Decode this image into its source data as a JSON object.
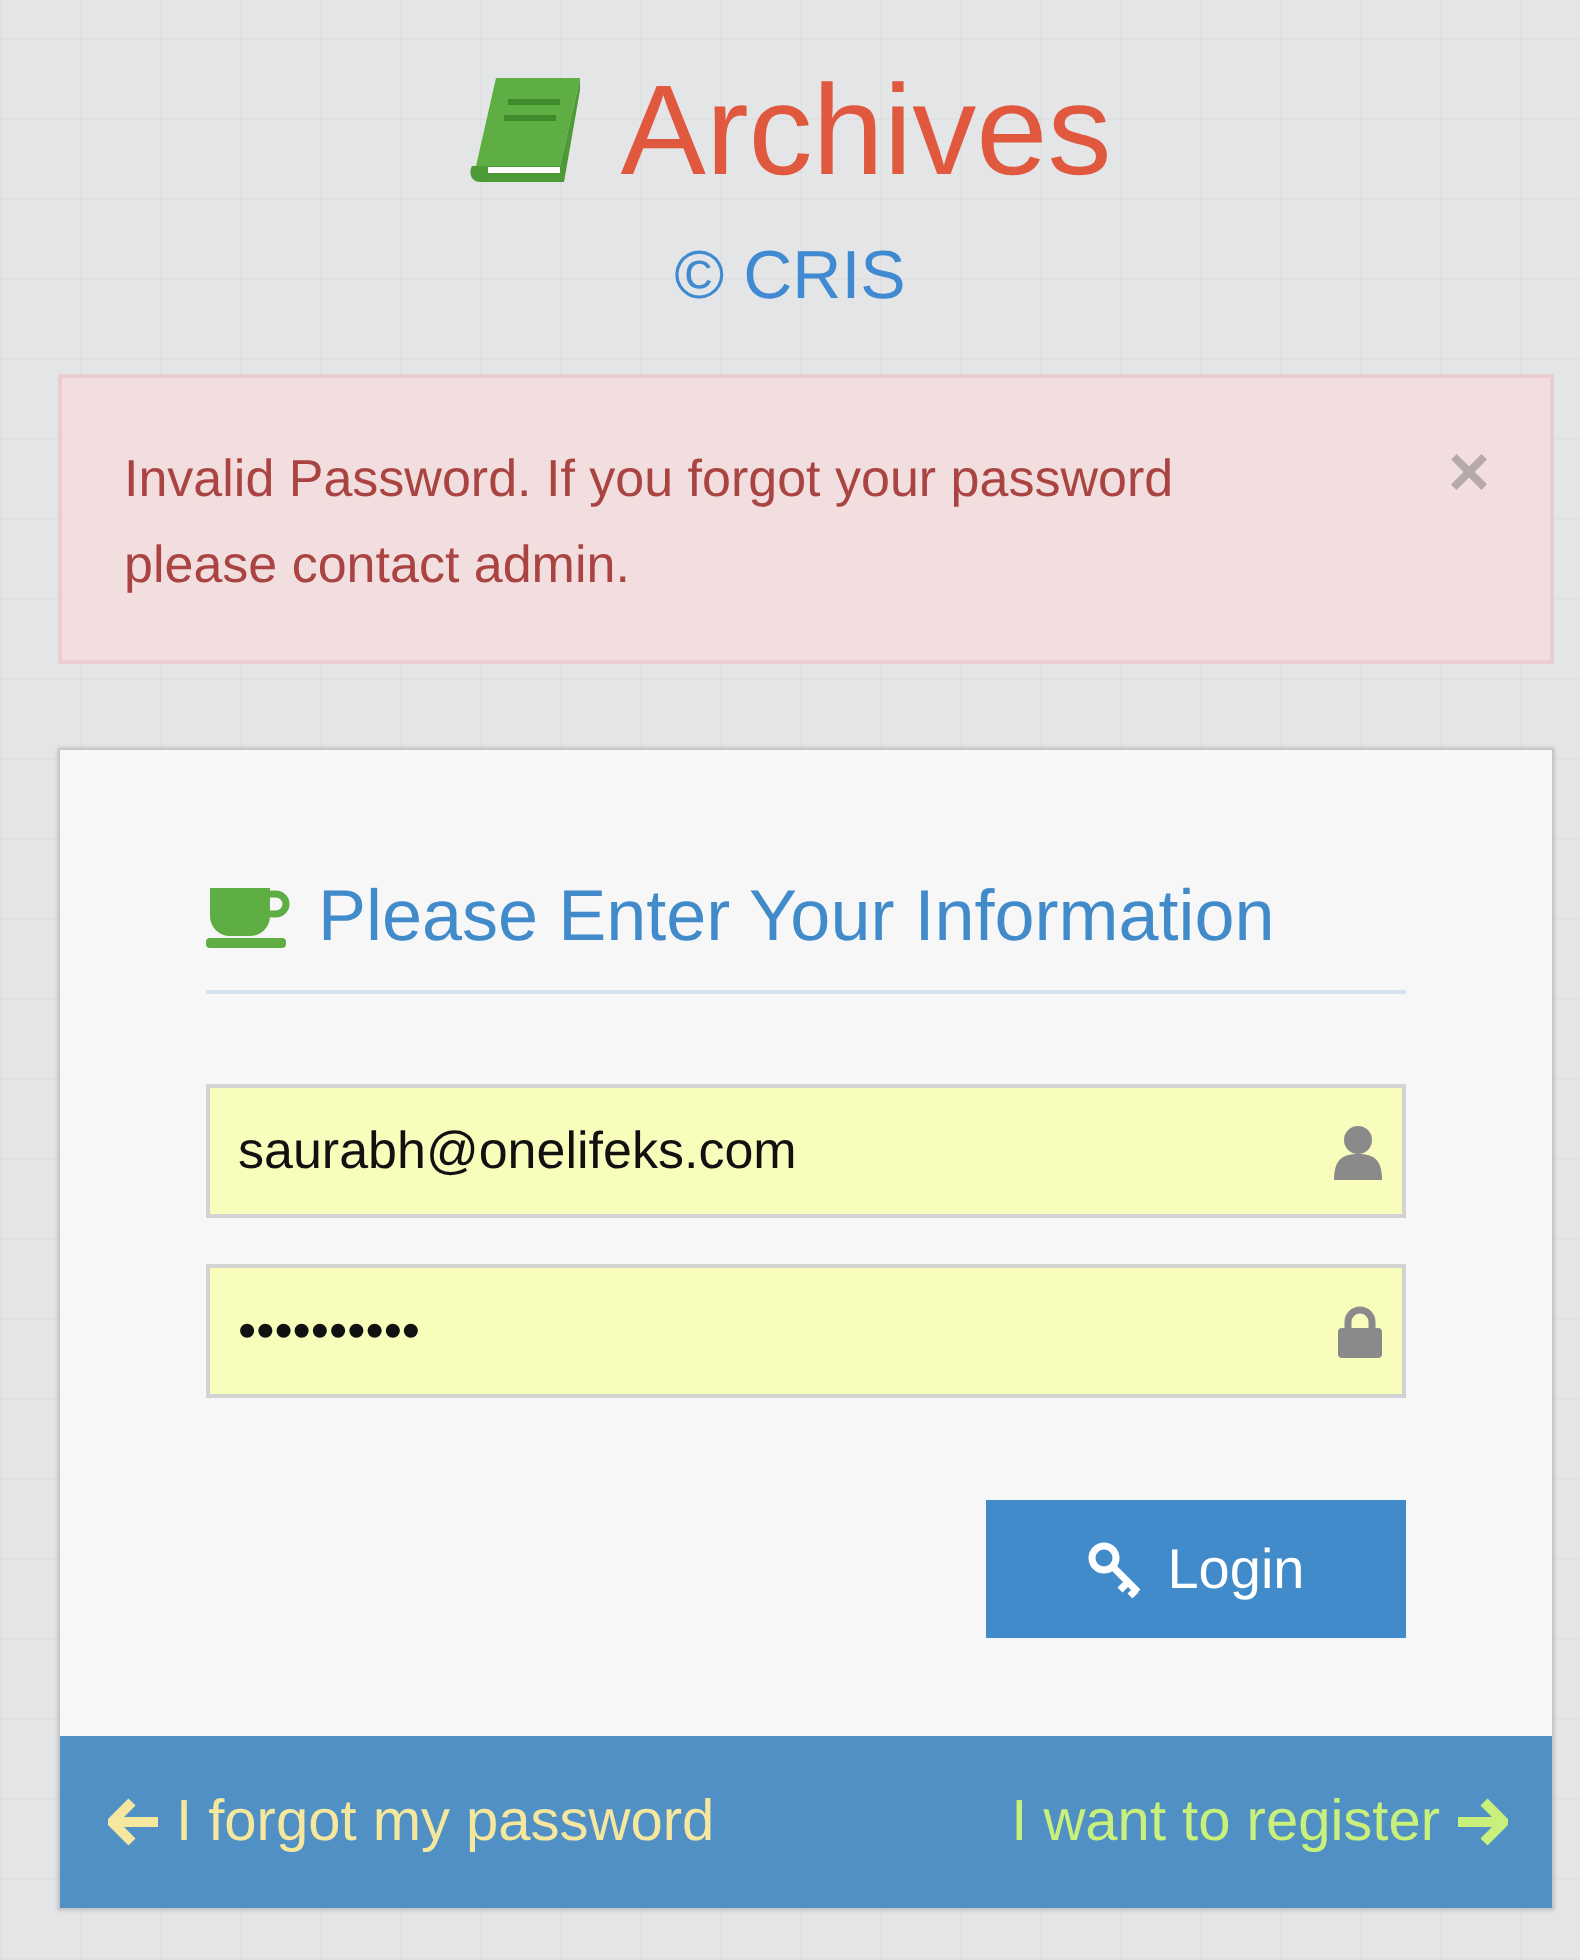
{
  "header": {
    "title": "Archives",
    "subtitle": "© CRIS"
  },
  "alert": {
    "message": "Invalid Password. If you forgot your password please contact admin.",
    "close": "×"
  },
  "form": {
    "heading": "Please Enter Your Information",
    "fields": [
      {
        "kind": "email",
        "value": "saurabh@onelifeks.com"
      },
      {
        "kind": "password",
        "value": "••••••••••"
      }
    ],
    "login_button": "Login"
  },
  "footer": {
    "links": [
      {
        "kind": "back",
        "label": "I forgot my password",
        "color": "#f5e79e"
      },
      {
        "kind": "forward",
        "label": "I want to register",
        "color": "#c8f07a"
      }
    ]
  }
}
